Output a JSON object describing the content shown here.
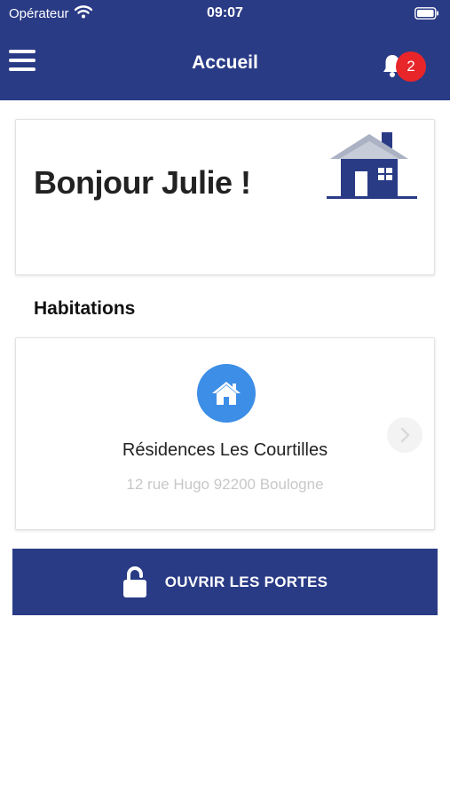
{
  "status_bar": {
    "carrier": "Opérateur",
    "time": "09:07",
    "wifi_icon": "wifi-icon",
    "battery_icon": "battery-icon"
  },
  "nav": {
    "title": "Accueil",
    "menu_icon": "hamburger-menu-icon",
    "bell_icon": "bell-icon",
    "notification_count": "2"
  },
  "greeting_card": {
    "greeting": "Bonjour Julie !",
    "illustration": "house-illustration"
  },
  "habitations": {
    "section_title": "Habitations",
    "items": [
      {
        "icon": "home-icon",
        "name": "Résidences Les Courtilles",
        "address": "12 rue Hugo 92200 Boulogne"
      }
    ],
    "next_icon": "chevron-right-icon"
  },
  "action": {
    "open_doors_label": "OUVRIR LES PORTES",
    "icon": "unlock-icon"
  },
  "colors": {
    "primary": "#2a3b86",
    "accent_blue": "#3d8ee6",
    "badge_red": "#e8262a"
  }
}
